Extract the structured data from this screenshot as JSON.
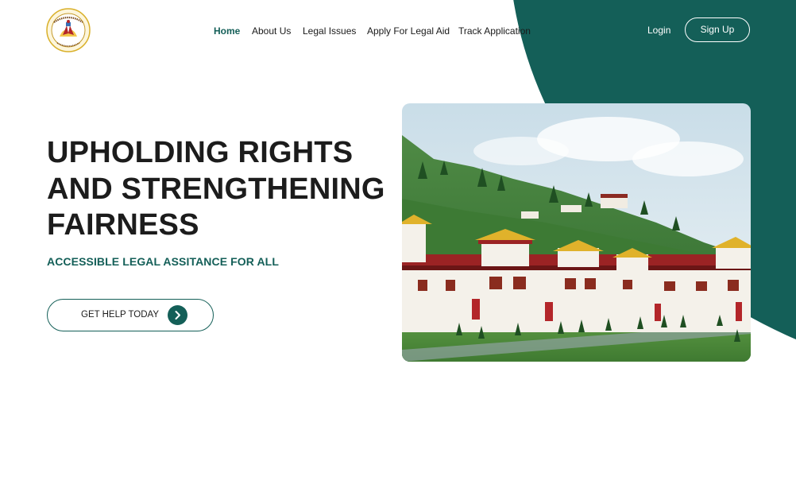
{
  "brand": {
    "logo_icon": "legal-aid-emblem-icon",
    "colors": {
      "primary": "#145f58",
      "text": "#1c1c1c",
      "accent_gold": "#d9b02a",
      "accent_red": "#b3262a"
    }
  },
  "nav": {
    "items": [
      {
        "label": "Home",
        "active": true
      },
      {
        "label": "About Us",
        "active": false
      },
      {
        "label": "Legal Issues",
        "active": false
      },
      {
        "label": "Apply For Legal Aid",
        "active": false
      },
      {
        "label": "Track Application",
        "active": false
      }
    ]
  },
  "auth": {
    "login_label": "Login",
    "signup_label": "Sign Up"
  },
  "hero": {
    "title_lines": [
      "UPHOLDING RIGHTS",
      "AND STRENGTHENING",
      "FAIRNESS"
    ],
    "subtitle": "ACCESSIBLE LEGAL ASSITANCE FOR ALL",
    "cta_label": "GET HELP TODAY",
    "cta_icon": "chevron-right-icon",
    "image_subject": "dzong-fortress-photo"
  }
}
